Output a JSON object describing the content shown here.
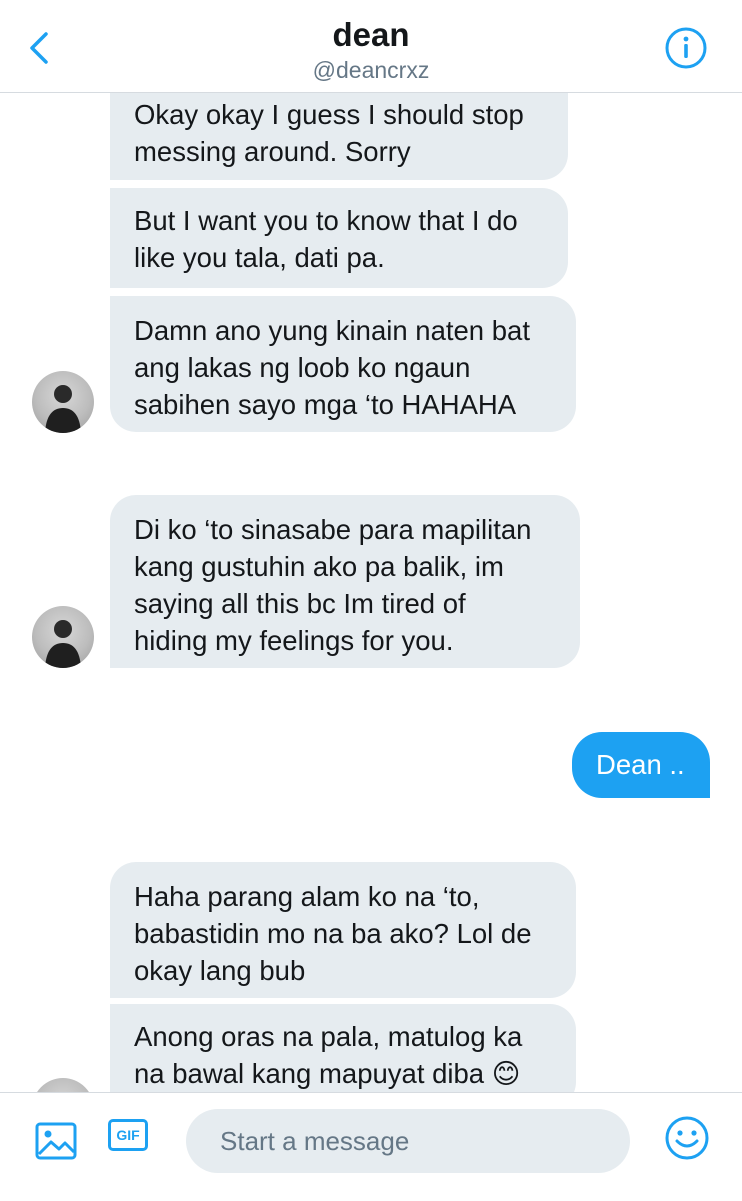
{
  "header": {
    "title": "dean",
    "handle": "@deancrxz"
  },
  "colors": {
    "accent": "#1da1f2",
    "received_bubble": "#e6ecf0",
    "secondary_text": "#657786"
  },
  "icons": {
    "back": "chevron-left-icon",
    "info": "info-icon",
    "image": "image-icon",
    "gif": "gif-icon",
    "emoji": "smiley-icon"
  },
  "messages": [
    {
      "from": "dean",
      "text": "Okay okay I guess I should stop\nmessing around. Sorry"
    },
    {
      "from": "dean",
      "text": "But I want you to know that I do\nlike you tala, dati pa."
    },
    {
      "from": "dean",
      "text": "Damn ano yung kinain naten bat\nang lakas ng loob ko ngaun\nsabihen sayo mga ‘to HAHAHA"
    },
    {
      "from": "dean",
      "text": "Di ko ‘to sinasabe para mapilitan\nkang gustuhin ako pa balik, im\nsaying all this bc Im tired of\nhiding my feelings for you."
    },
    {
      "from": "me",
      "text": "Dean .."
    },
    {
      "from": "dean",
      "text": "Haha parang alam ko na ‘to,\nbabastidin mo na ba ako? Lol de\nokay lang bub"
    },
    {
      "from": "dean",
      "text": "Anong oras na pala, matulog ka\nna bawal kang mapuyat diba 😊"
    }
  ],
  "composer": {
    "gif_label": "GIF",
    "placeholder": "Start a message"
  }
}
